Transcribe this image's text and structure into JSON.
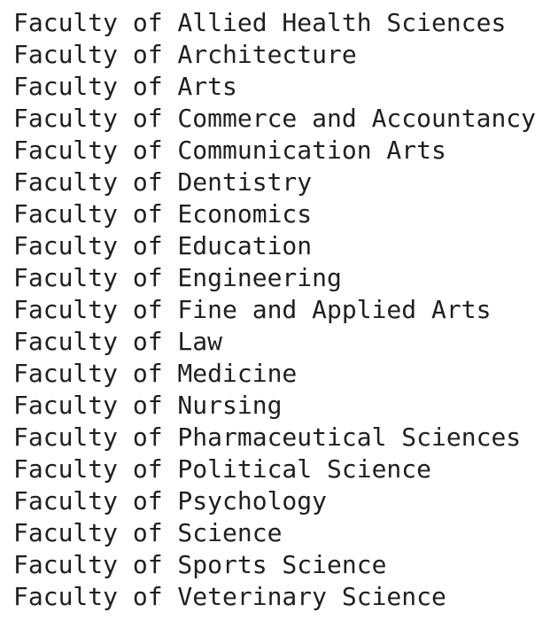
{
  "faculties": [
    "Faculty of Allied Health Sciences",
    "Faculty of Architecture",
    "Faculty of Arts",
    "Faculty of Commerce and Accountancy",
    "Faculty of Communication Arts",
    "Faculty of Dentistry",
    "Faculty of Economics",
    "Faculty of Education",
    "Faculty of Engineering",
    "Faculty of Fine and Applied Arts",
    "Faculty of Law",
    "Faculty of Medicine",
    "Faculty of Nursing",
    "Faculty of Pharmaceutical Sciences",
    "Faculty of Political Science",
    "Faculty of Psychology",
    "Faculty of Science",
    "Faculty of Sports Science",
    "Faculty of Veterinary Science"
  ]
}
